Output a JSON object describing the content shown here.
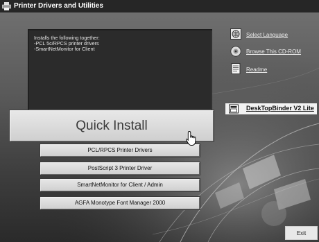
{
  "window": {
    "title": "Printer Drivers and Utilities"
  },
  "description": {
    "lines": [
      "Installs the following together:",
      "-PCL 5c/RPCS printer drivers",
      "-SmartNetMonitor for Client"
    ]
  },
  "buttons": {
    "quick_install": "Quick Install",
    "pcl_rpcs": "PCL/RPCS Printer Drivers",
    "postscript3": "PostScript 3 Printer Driver",
    "smartnetmonitor": "SmartNetMonitor for Client / Admin",
    "agfa": "AGFA Monotype Font Manager 2000",
    "exit": "Exit"
  },
  "links": {
    "select_language": "Select Language",
    "browse_cdrom": "Browse This CD-ROM",
    "readme": "Readme",
    "desktopbinder": "DeskTopBinder V2 Lite"
  },
  "icons": {
    "app": "printer-icon",
    "select_language": "globe-icon",
    "browse_cdrom": "cd-rom-icon",
    "readme": "document-icon",
    "desktopbinder": "binder-icon",
    "cursor": "hand-pointer-icon"
  },
  "colors": {
    "titlebar": "#262626",
    "background": "#5a5a5a",
    "panel": "#2b2b2b",
    "button_face": "#d9d9d9"
  }
}
